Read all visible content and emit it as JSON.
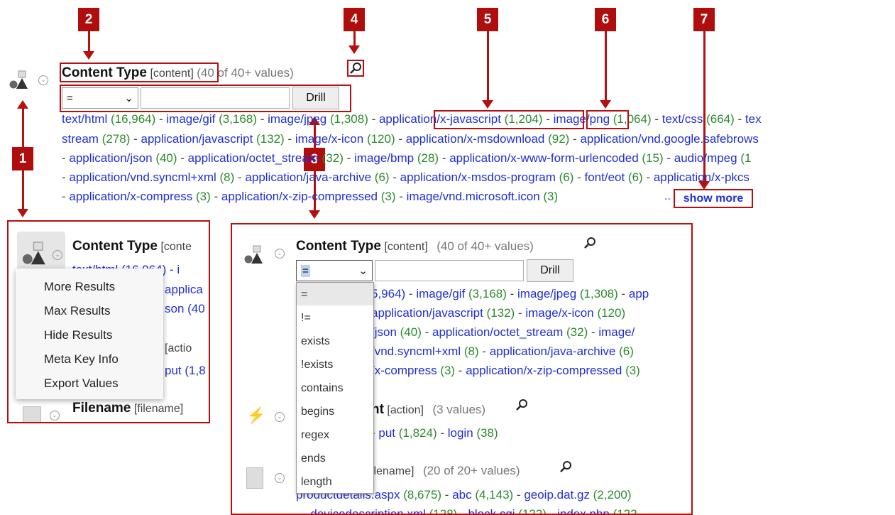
{
  "markers": [
    "1",
    "2",
    "3",
    "4",
    "5",
    "6",
    "7"
  ],
  "main": {
    "title": "Content Type",
    "key": "[content]",
    "count": "(40 of 40+ values)",
    "operator": "=",
    "drill_label": "Drill",
    "rows": [
      [
        [
          "text/html",
          "(16,964)"
        ],
        [
          "image/gif",
          "(3,168)"
        ],
        [
          "image/jpeg",
          "(1,308)"
        ],
        [
          "application/x-javascript",
          "(1,204)"
        ],
        [
          "image/png",
          "(1,064)"
        ],
        [
          "text/css",
          "(664)"
        ],
        [
          "tex",
          ""
        ]
      ],
      [
        [
          "stream",
          "(278)"
        ],
        [
          "application/javascript",
          "(132)"
        ],
        [
          "image/x-icon",
          "(120)"
        ],
        [
          "application/x-msdownload",
          "(92)"
        ],
        [
          "application/vnd.google.safebrows",
          ""
        ]
      ],
      [
        [
          "application/json",
          "(40)"
        ],
        [
          "application/octet_stream",
          "(32)"
        ],
        [
          "image/bmp",
          "(28)"
        ],
        [
          "application/x-www-form-urlencoded",
          "(15)"
        ],
        [
          "audio/mpeg",
          "(1"
        ]
      ],
      [
        [
          "application/vnd.syncml+xml",
          "(8)"
        ],
        [
          "application/java-archive",
          "(6)"
        ],
        [
          "application/x-msdos-program",
          "(6)"
        ],
        [
          "font/eot",
          "(6)"
        ],
        [
          "application/x-pkcs",
          ""
        ]
      ],
      [
        [
          "application/x-compress",
          "(3)"
        ],
        [
          "application/x-zip-compressed",
          "(3)"
        ],
        [
          "image/vnd.microsoft.icon",
          "(3)"
        ]
      ]
    ],
    "ellipsis": "..",
    "show_more": "show more"
  },
  "left_panel": {
    "title": "Content Type",
    "key": "[conte",
    "partial_values": [
      "text/html (16,964) - i",
      "applica",
      "son (40",
      "[actio",
      "put (1,8"
    ],
    "menu": [
      "More Results",
      "Max Results",
      "Hide Results",
      "Meta Key Info",
      "Export Values"
    ],
    "bottom_title": "Filename",
    "bottom_key": "[filename]"
  },
  "right_panel": {
    "title": "Content Type",
    "key": "[content]",
    "count": "(40 of 40+ values)",
    "operator": "=",
    "drill_label": "Drill",
    "rows": [
      [
        [
          "5,964)",
          ""
        ],
        [
          "image/gif",
          "(3,168)"
        ],
        [
          "image/jpeg",
          "(1,308)"
        ],
        [
          "app",
          ""
        ]
      ],
      [
        [
          "application/javascript",
          "(132)"
        ],
        [
          "image/x-icon",
          "(120)"
        ]
      ],
      [
        [
          "/json",
          "(40)"
        ],
        [
          "application/octet_stream",
          "(32)"
        ],
        [
          "image/",
          ""
        ]
      ],
      [
        [
          "/vnd.syncml+xml",
          "(8)"
        ],
        [
          "application/java-archive",
          "(6)"
        ]
      ],
      [
        [
          "/x-compress",
          "(3)"
        ],
        [
          "application/x-zip-compressed",
          "(3)"
        ]
      ]
    ],
    "dropdown": [
      "=",
      "!=",
      "exists",
      "!exists",
      "contains",
      "begins",
      "regex",
      "ends",
      "length"
    ],
    "action_title": "nt",
    "action_key": "[action]",
    "action_count": "(3 values)",
    "action_values": [
      [
        "put",
        "(1,824)"
      ],
      [
        "login",
        "(38)"
      ]
    ],
    "file_key": "ilename]",
    "file_count": "(20 of 20+ values)",
    "file_values": [
      [
        "productdetails.aspx",
        "(8,675)"
      ],
      [
        "abc",
        "(4,143)"
      ],
      [
        "geoip.dat.gz",
        "(2,200)"
      ]
    ],
    "file_values2": [
      [
        "devicedescription.xml",
        "(128)"
      ],
      [
        "block.cgi",
        "(122)"
      ],
      [
        "index.php",
        "(122"
      ]
    ]
  }
}
